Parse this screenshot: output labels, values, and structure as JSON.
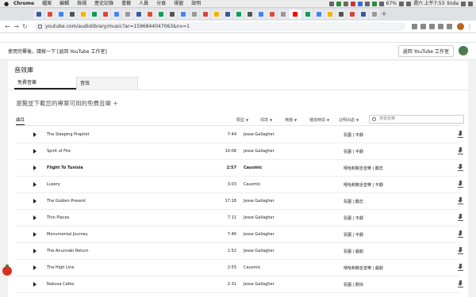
{
  "menubar": {
    "app": "Chrome",
    "items": [
      "檔案",
      "編輯",
      "檢視",
      "歷史記錄",
      "書籤",
      "人員",
      "分頁",
      "視窗",
      "說明"
    ],
    "battery": "67%",
    "clock": "週六 上午7:53",
    "user": "linda"
  },
  "browser": {
    "url": "youtube.com/audiolibrary/music?ar=1596844047063&nv=1",
    "new_tab": "+"
  },
  "notice": "使用完畢後，請按一下 [返回 YouTube 工作室]",
  "back_button": "返回 YouTube 工作室",
  "library": {
    "title": "音效庫",
    "tabs": [
      "免費音樂",
      "音效"
    ],
    "browse_heading": "瀏覽並下載您的專案可用的免費音樂",
    "tracks_tab": "曲目",
    "filters": [
      "類型",
      "情境",
      "樂器",
      "播放時間",
      "註明出處"
    ],
    "search_placeholder": "搜尋音樂"
  },
  "tracks": [
    {
      "title": "The Sleeping Prophet",
      "duration": "7:44",
      "artist": "Jesse Gallagher",
      "genre": "氛圍 | 平靜",
      "bold": false
    },
    {
      "title": "Spirit of Fire",
      "duration": "10:08",
      "artist": "Jesse Gallagher",
      "genre": "氛圍 | 平靜",
      "bold": false
    },
    {
      "title": "Flight To Tunisia",
      "duration": "2:57",
      "artist": "Causmic",
      "genre": "嘻哈和饒舌音樂 | 勵志",
      "bold": true
    },
    {
      "title": "Luxery",
      "duration": "3:03",
      "artist": "Causmic",
      "genre": "嘻哈和饒舌音樂 | 平靜",
      "bold": false
    },
    {
      "title": "The Golden Present",
      "duration": "17:18",
      "artist": "Jesse Gallagher",
      "genre": "氛圍 | 勵志",
      "bold": false
    },
    {
      "title": "Thin Places",
      "duration": "7:11",
      "artist": "Jesse Gallagher",
      "genre": "氛圍 | 平靜",
      "bold": false
    },
    {
      "title": "Monumental Journey",
      "duration": "7:46",
      "artist": "Jesse Gallagher",
      "genre": "氛圍 | 平靜",
      "bold": false
    },
    {
      "title": "The Anunnaki Return",
      "duration": "1:52",
      "artist": "Jesse Gallagher",
      "genre": "氛圍 | 戲劇",
      "bold": false
    },
    {
      "title": "The High Line",
      "duration": "2:55",
      "artist": "Causmic",
      "genre": "嘻哈和饒舌音樂 | 戲劇",
      "bold": false
    },
    {
      "title": "Nakusa Cafeo",
      "duration": "2:31",
      "artist": "Jesse Gallagher",
      "genre": "氛圍 | 歡快",
      "bold": false
    }
  ]
}
